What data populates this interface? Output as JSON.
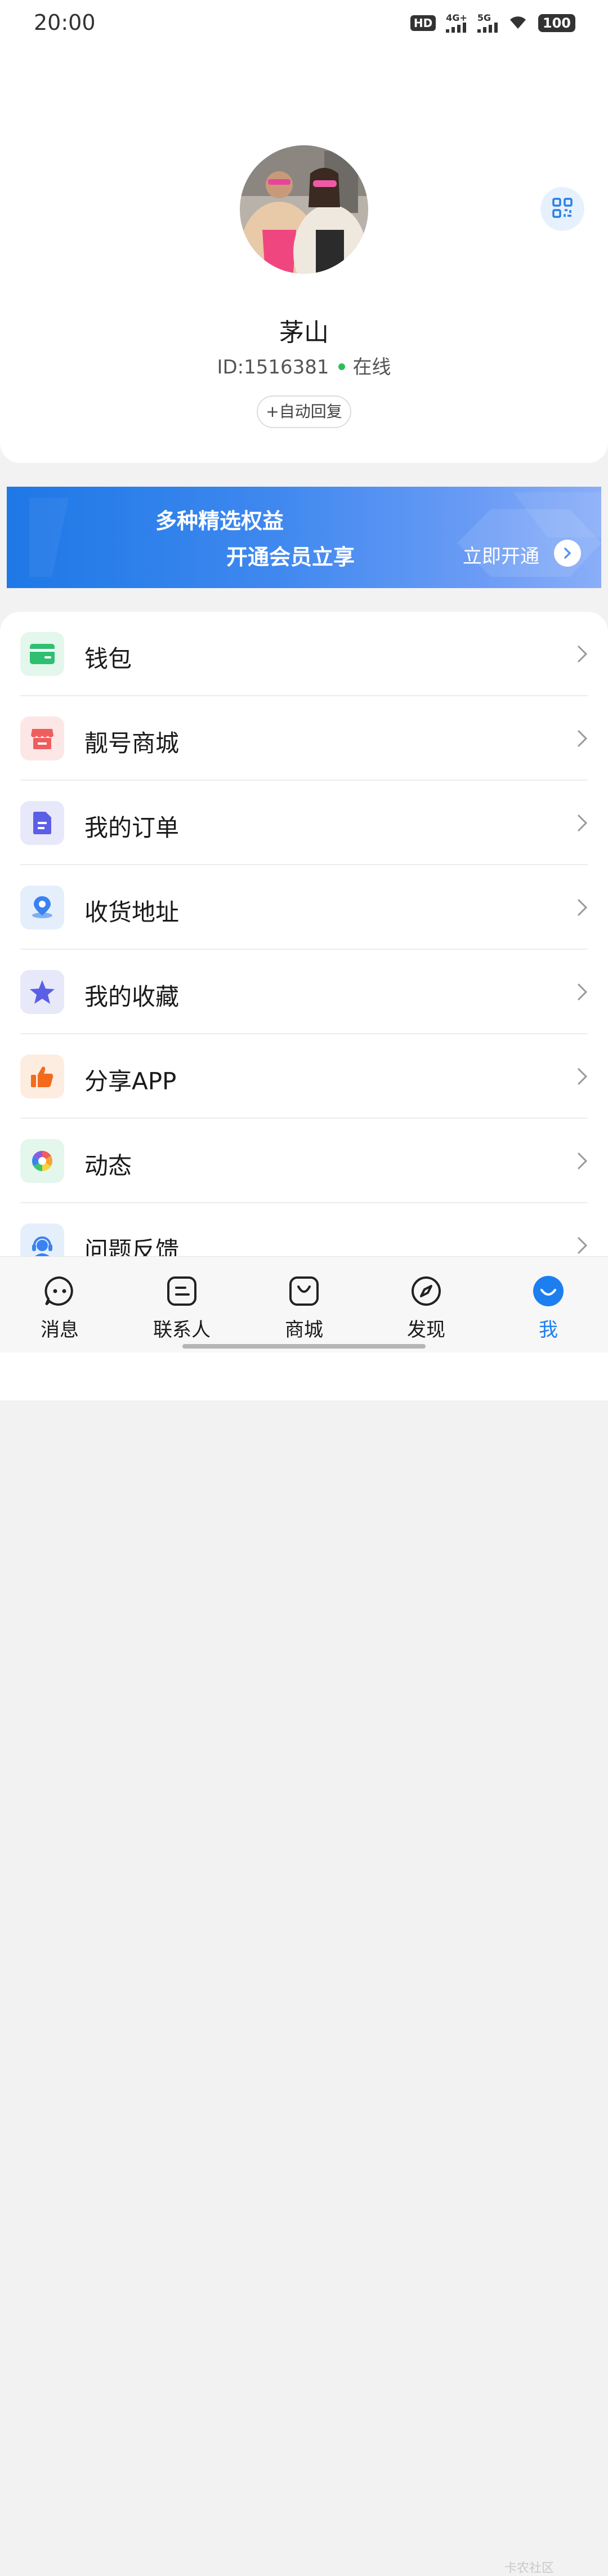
{
  "status_bar": {
    "time": "20:00",
    "hd": "HD",
    "sim1": "4G+",
    "sim2": "5G",
    "battery": "100",
    "icons": [
      "hd-icon",
      "signal-4g-icon",
      "signal-5g-icon",
      "wifi-icon",
      "battery-icon"
    ]
  },
  "profile": {
    "name": "茅山",
    "id": "ID:1516381",
    "status": "在线",
    "auto_reply": "+自动回复",
    "qr_icon": "qr-code-icon",
    "status_color": "#2bbf5a"
  },
  "vip_banner": {
    "line1": "多种精选权益",
    "line2": "开通会员立享",
    "cta": "立即开通"
  },
  "menu": {
    "items": [
      {
        "label": "钱包",
        "icon": "wallet-icon",
        "color": "#2fbf71"
      },
      {
        "label": "靓号商城",
        "icon": "store-icon",
        "color": "#ef5d5d"
      },
      {
        "label": "我的订单",
        "icon": "order-document-icon",
        "color": "#5b5fe6"
      },
      {
        "label": "收货地址",
        "icon": "location-pin-icon",
        "color": "#3b82f0"
      },
      {
        "label": "我的收藏",
        "icon": "star-icon",
        "color": "#5b5fe6"
      },
      {
        "label": "分享APP",
        "icon": "thumbs-up-icon",
        "color": "#f26b1d"
      },
      {
        "label": "动态",
        "icon": "aperture-icon",
        "color": "#2fbf71"
      },
      {
        "label": "问题反馈",
        "icon": "support-agent-icon",
        "color": "#3b82f0"
      }
    ]
  },
  "nav": {
    "tabs": [
      {
        "label": "消息",
        "icon": "message-icon"
      },
      {
        "label": "联系人",
        "icon": "contacts-icon"
      },
      {
        "label": "商城",
        "icon": "shopping-bag-icon"
      },
      {
        "label": "发现",
        "icon": "compass-icon"
      },
      {
        "label": "我",
        "icon": "me-icon"
      }
    ],
    "active_index": 4,
    "active_color": "#1d7ef0"
  },
  "watermark": "卡农社区"
}
